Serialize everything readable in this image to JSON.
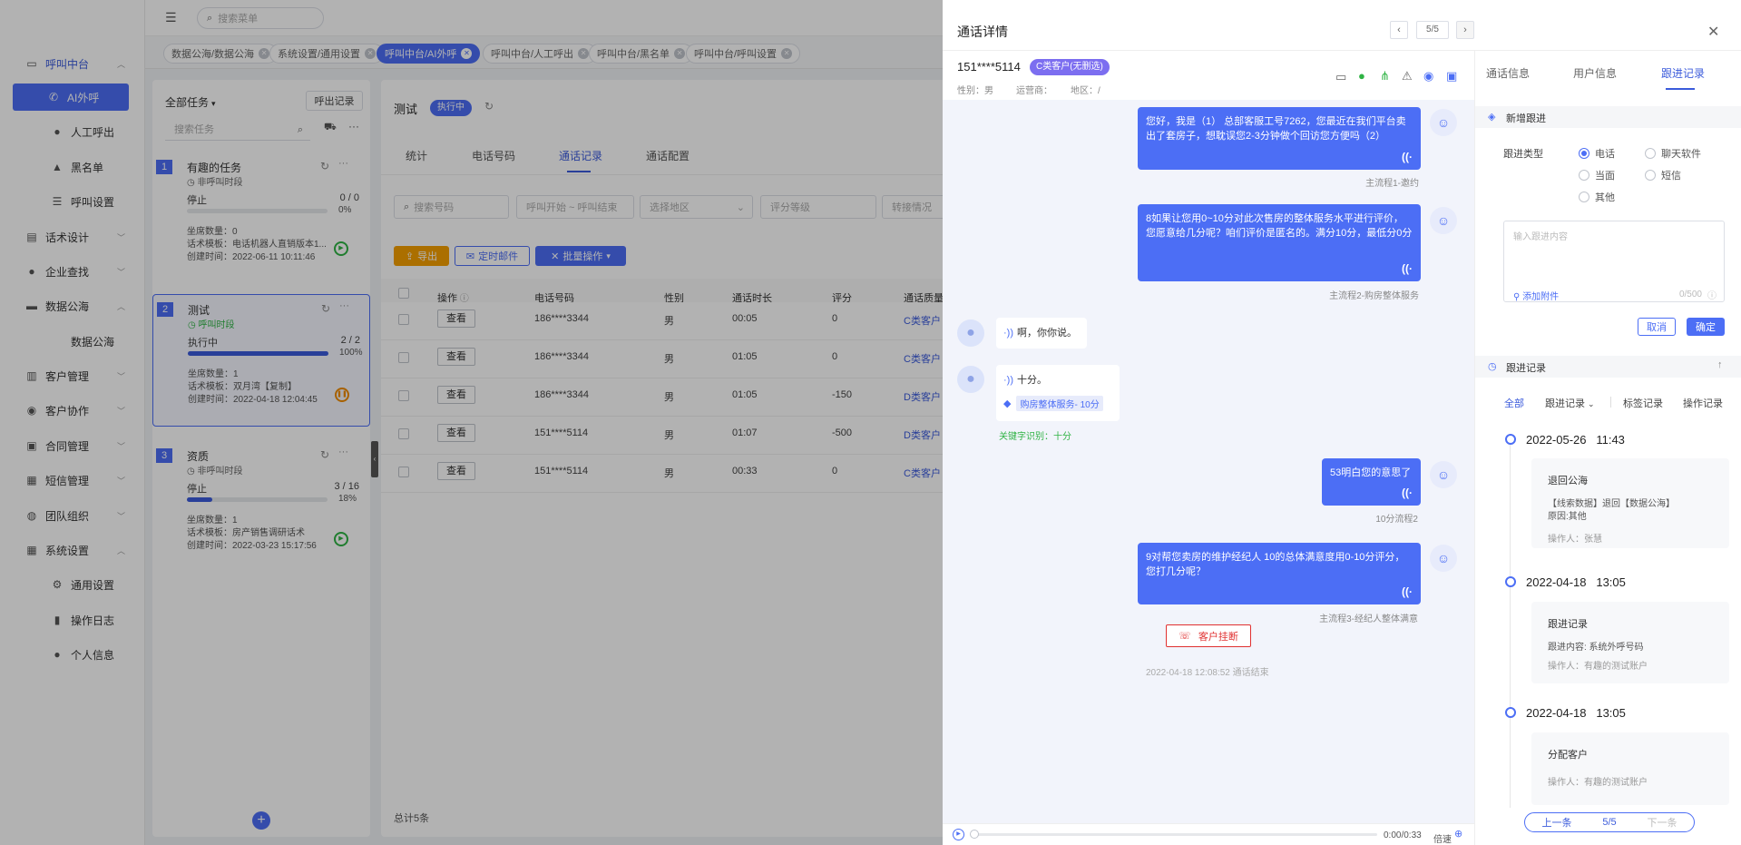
{
  "sidebar": {
    "items": [
      {
        "label": "呼叫中台",
        "icon": "monitor-icon"
      },
      {
        "label": "AI外呼",
        "icon": "phone-icon"
      },
      {
        "label": "人工呼出",
        "icon": "person-icon"
      },
      {
        "label": "黑名单",
        "icon": "warning-icon"
      },
      {
        "label": "呼叫设置",
        "icon": "sliders-icon"
      },
      {
        "label": "话术设计",
        "icon": "script-icon"
      },
      {
        "label": "企业查找",
        "icon": "bulb-icon"
      },
      {
        "label": "数据公海",
        "icon": "data-icon"
      },
      {
        "label": "数据公海",
        "icon": ""
      },
      {
        "label": "客户管理",
        "icon": "book-icon"
      },
      {
        "label": "客户协作",
        "icon": "users-icon"
      },
      {
        "label": "合同管理",
        "icon": "contract-icon"
      },
      {
        "label": "短信管理",
        "icon": "sms-icon"
      },
      {
        "label": "团队组织",
        "icon": "team-icon"
      },
      {
        "label": "系统设置",
        "icon": "grid-icon"
      },
      {
        "label": "通用设置",
        "icon": "gear-icon"
      },
      {
        "label": "操作日志",
        "icon": "log-icon"
      },
      {
        "label": "个人信息",
        "icon": "user-icon"
      }
    ]
  },
  "topbar": {
    "search_placeholder": "搜索菜单"
  },
  "tabs": [
    {
      "label": "数据公海/数据公海"
    },
    {
      "label": "系统设置/通用设置"
    },
    {
      "label": "呼叫中台/AI外呼"
    },
    {
      "label": "呼叫中台/人工呼出"
    },
    {
      "label": "呼叫中台/黑名单"
    },
    {
      "label": "呼叫中台/呼叫设置"
    }
  ],
  "tasks": {
    "filter_label": "全部任务",
    "record_button": "呼出记录",
    "search_placeholder": "搜索任务",
    "items": [
      {
        "num": "1",
        "title": "有趣的任务",
        "sub": "非呼叫时段",
        "status": "停止",
        "count": "0 / 0",
        "pct": "0%",
        "progress": 0,
        "seats": "坐席数量：0",
        "script": "话术模板：电话机器人直销版本1...",
        "created": "创建时间：2022-06-11 10:11:46"
      },
      {
        "num": "2",
        "title": "测试",
        "sub": "呼叫时段",
        "status": "执行中",
        "count": "2 / 2",
        "pct": "100%",
        "progress": 1,
        "seats": "坐席数量：1",
        "script": "话术模板：双月湾【复制】",
        "created": "创建时间：2022-04-18 12:04:45"
      },
      {
        "num": "3",
        "title": "资质",
        "sub": "非呼叫时段",
        "status": "停止",
        "count": "3 / 16",
        "pct": "18%",
        "progress": 0.18,
        "seats": "坐席数量：1",
        "script": "话术模板：房产销售调研话术",
        "created": "创建时间：2022-03-23 15:17:56"
      }
    ]
  },
  "main": {
    "title": "测试",
    "status_badge": "执行中",
    "tabs": [
      "统计",
      "电话号码",
      "通话记录",
      "通话配置"
    ],
    "filters": [
      "搜索号码",
      "呼叫开始 ~ 呼叫结束",
      "选择地区",
      "评分等级",
      "转接情况"
    ],
    "buttons": [
      "导出",
      "定时邮件",
      "批量操作"
    ],
    "columns": [
      "操作",
      "电话号码",
      "性别",
      "通话时长",
      "评分",
      "通话质量"
    ],
    "rows": [
      {
        "action": "查看",
        "phone": "186****3344",
        "gender": "男",
        "duration": "00:05",
        "score": "0",
        "quality": "C类客户"
      },
      {
        "action": "查看",
        "phone": "186****3344",
        "gender": "男",
        "duration": "01:05",
        "score": "0",
        "quality": "C类客户"
      },
      {
        "action": "查看",
        "phone": "186****3344",
        "gender": "男",
        "duration": "01:05",
        "score": "-150",
        "quality": "D类客户"
      },
      {
        "action": "查看",
        "phone": "151****5114",
        "gender": "男",
        "duration": "01:07",
        "score": "-500",
        "quality": "D类客户"
      },
      {
        "action": "查看",
        "phone": "151****5114",
        "gender": "男",
        "duration": "00:33",
        "score": "0",
        "quality": "C类客户"
      }
    ],
    "total": "总计5条"
  },
  "drawer": {
    "title": "通话详情",
    "pager": "5/5",
    "phone": "151****5114",
    "customer_tag": "C类客户(无删选)",
    "gender": "性别：男",
    "carrier": "运营商：",
    "region": "地区：/",
    "messages": [
      {
        "side": "right",
        "text": "您好，我是（1） 总部客服工号7262，您最近在我们平台卖出了套房子，想耽误您2-3分钟做个回访您方便吗（2）",
        "caption": "主流程1-邀约"
      },
      {
        "side": "right",
        "text": "8如果让您用0~10分对此次售房的整体服务水平进行评价，您愿意给几分呢？咱们评价是匿名的。满分10分，最低分0分",
        "caption": "主流程2-购房整体服务"
      },
      {
        "side": "left",
        "text": "啊，你你说。"
      },
      {
        "side": "left",
        "text": "十分。",
        "tag": "购房整体服务- 10分",
        "keyword": "关键字识别：十分"
      },
      {
        "side": "right",
        "text": "53明白您的意思了",
        "caption": "10分流程2"
      },
      {
        "side": "right",
        "text": "9对帮您卖房的维护经纪人 10的总体满意度用0-10分评分，您打几分呢？",
        "caption": "主流程3-经纪人整体满意"
      }
    ],
    "hangup": "客户挂断",
    "end_note": "2022-04-18 12:08:52  通话结束",
    "player_time": "0:00/0:33",
    "speed": "倍速"
  },
  "right": {
    "tabs": [
      "通话信息",
      "用户信息",
      "跟进记录"
    ],
    "new_followup": "新增跟进",
    "type_label": "跟进类型",
    "types": [
      "电话",
      "聊天软件",
      "当面",
      "短信",
      "其他"
    ],
    "textarea_placeholder": "输入跟进内容",
    "attach": "添加附件",
    "counter": "0/500",
    "cancel": "取消",
    "confirm": "确定",
    "records_title": "跟进记录",
    "filters": [
      "全部",
      "跟进记录",
      "标签记录",
      "操作记录"
    ],
    "timeline": [
      {
        "date": "2022-05-26",
        "time": "11:43",
        "title": "退回公海",
        "lines": [
          "【线索数据】退回【数据公海】",
          "原因:其他"
        ],
        "operator": "操作人：张慧"
      },
      {
        "date": "2022-04-18",
        "time": "13:05",
        "title": "跟进记录",
        "lines": [
          "跟进内容: 系统外呼号码"
        ],
        "operator": "操作人：有趣的测试账户"
      },
      {
        "date": "2022-04-18",
        "time": "13:05",
        "title": "分配客户",
        "lines": [],
        "operator": "操作人：有趣的测试账户"
      }
    ],
    "pager": {
      "prev": "上一条",
      "count": "5/5",
      "next": "下一条"
    }
  }
}
